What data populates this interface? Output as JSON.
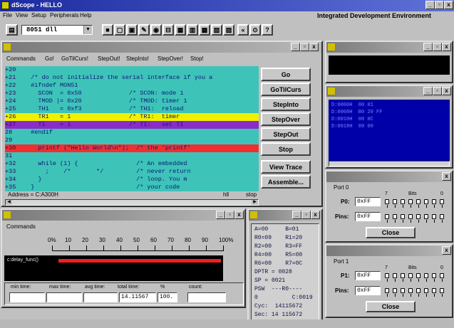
{
  "app": {
    "title": "dScope - HELLO",
    "ide_label": "Integrated Development Environment",
    "menu": [
      "File",
      "View",
      "Setup",
      "Peripherals",
      "Help"
    ],
    "target_select": "8051 dll"
  },
  "debug_window": {
    "menu": [
      "Commands",
      "Go!",
      "GoTilCurs!",
      "StepOut!",
      "StepInto!",
      "StepOver!",
      "Stop!"
    ],
    "lines": [
      {
        "n": "+20",
        "text": "",
        "hl": ""
      },
      {
        "n": "+21",
        "text": "  /* do not initialize the serial interface if you a",
        "hl": ""
      },
      {
        "n": "+22",
        "text": "  #ifndef MON51",
        "hl": ""
      },
      {
        "n": "+23",
        "text": "    SCON  = 0x50             /* SCON: mode 1",
        "hl": ""
      },
      {
        "n": "+24",
        "text": "    TMOD |= 0x20             /* TMOD: timer 1",
        "hl": ""
      },
      {
        "n": "+25",
        "text": "    TH1   = 0xf3             /* TH1:  reload",
        "hl": ""
      },
      {
        "n": "+26",
        "text": "    TR1   = 1                /* TR1:  timer",
        "hl": "yellow"
      },
      {
        "n": "+27",
        "text": "    TI    = 1                /* TI:   set TI",
        "hl": "purple"
      },
      {
        "n": "28",
        "text": "  #endif",
        "hl": ""
      },
      {
        "n": "29",
        "text": "",
        "hl": ""
      },
      {
        "n": "+30",
        "text": "    printf (\"Hello World\\n\");  /* the 'printf'",
        "hl": "red"
      },
      {
        "n": "31",
        "text": "",
        "hl": ""
      },
      {
        "n": "+32",
        "text": "    while (1) {                /* An embedded",
        "hl": ""
      },
      {
        "n": "+33",
        "text": "      ;    /*       */         /* never return",
        "hl": ""
      },
      {
        "n": "+34",
        "text": "    }                          /* loop. You m",
        "hl": ""
      },
      {
        "n": "+35",
        "text": "  }                            /* your code",
        "hl": ""
      }
    ],
    "buttons": [
      "Go",
      "GoTilCurs",
      "StepInto",
      "StepOver",
      "StepOut",
      "Stop",
      "View Trace",
      "Assemble..."
    ],
    "status_address": "Address = C:A300H",
    "status_hll": "hll",
    "status_stop": "stop"
  },
  "perf_window": {
    "commands_label": "Commands",
    "scale": [
      "0%",
      "10",
      "20",
      "30",
      "40",
      "50",
      "60",
      "70",
      "80",
      "90",
      "100%"
    ],
    "bar_label": "c:delay_func()",
    "bar_fraction": 1.0,
    "fields_labels": [
      "min time:",
      "max time:",
      "avg time:",
      "total time:",
      "%",
      "count:"
    ],
    "fields_values": [
      "",
      "",
      "",
      "14.11567",
      "100.",
      ""
    ]
  },
  "registers": {
    "rows": [
      "A=00     B=01",
      "R0=09    R1=20",
      "R2=00    R3=FF",
      "R4=00    R5=00",
      "R6=00    R7=0C",
      "DPTR = 0028",
      "SP = 0021",
      "PSW  ---R0----",
      "0          C:0019",
      "Cyc:  14115672",
      "Sec: 14 115672"
    ]
  },
  "memory_window": {
    "lines": [
      "D:0000H  00 01",
      "D:0008H  B0 20 FF",
      "D:0010H  00 0C",
      "D:0018H  00 00"
    ]
  },
  "port0": {
    "title": "Port 0",
    "reg_label": "P0:",
    "reg_value": "0xFF",
    "pins_label": "Pins:",
    "pins_value": "0xFF",
    "bit_hi": "7",
    "bits_label": "Bits",
    "bit_lo": "0",
    "close": "Close"
  },
  "port1": {
    "title": "Port 1",
    "reg_label": "P1:",
    "reg_value": "0xFF",
    "pins_label": "Pins:",
    "pins_value": "0xFF",
    "bit_hi": "7",
    "bits_label": "Bits",
    "bit_lo": "0",
    "close": "Close"
  }
}
